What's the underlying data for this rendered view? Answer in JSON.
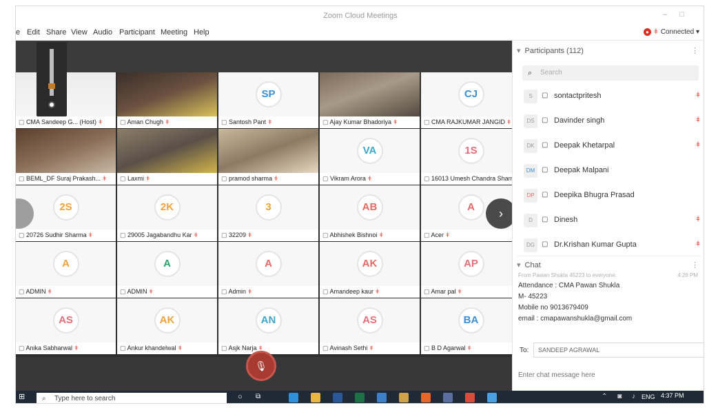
{
  "window": {
    "title": "Zoom Cloud Meetings"
  },
  "menu": {
    "items": [
      "e",
      "Edit",
      "Share",
      "View",
      "Audio",
      "Participant",
      "Meeting",
      "Help"
    ],
    "status": "Connected"
  },
  "tiles": [
    {
      "name": "CMA Sandeep G... (Host)",
      "kind": "video-dark",
      "initials": ""
    },
    {
      "name": "Aman Chugh",
      "kind": "video",
      "initials": ""
    },
    {
      "name": "Santosh Pant",
      "kind": "avatar",
      "initials": "SP",
      "color": "blue"
    },
    {
      "name": "Ajay Kumar Bhadoriya",
      "kind": "video",
      "initials": ""
    },
    {
      "name": "CMA RAJKUMAR JANGID",
      "kind": "avatar",
      "initials": "CJ",
      "color": "blue"
    },
    {
      "name": "BEML_DF Suraj Prakash...",
      "kind": "video",
      "initials": ""
    },
    {
      "name": "Laxmi",
      "kind": "video",
      "initials": ""
    },
    {
      "name": "pramod sharma",
      "kind": "video",
      "initials": ""
    },
    {
      "name": "Vikram Arora",
      "kind": "avatar",
      "initials": "VA",
      "color": "teal"
    },
    {
      "name": "16013 Umesh Chandra Sharma",
      "kind": "avatar",
      "initials": "1S",
      "color": "pink"
    },
    {
      "name": "20726 Sudhir Sharma",
      "kind": "avatar",
      "initials": "2S",
      "color": "orange"
    },
    {
      "name": "29005 Jagabandhu Kar",
      "kind": "avatar",
      "initials": "2K",
      "color": "orange"
    },
    {
      "name": "32209",
      "kind": "avatar",
      "initials": "3",
      "color": "orange"
    },
    {
      "name": "Abhishek Bishnoi",
      "kind": "avatar",
      "initials": "AB",
      "color": "red"
    },
    {
      "name": "Acer",
      "kind": "avatar",
      "initials": "A",
      "color": "red"
    },
    {
      "name": "ADMIN",
      "kind": "avatar",
      "initials": "A",
      "color": "orange"
    },
    {
      "name": "ADMIN",
      "kind": "avatar",
      "initials": "A",
      "color": "green"
    },
    {
      "name": "Admin",
      "kind": "avatar",
      "initials": "A",
      "color": "red"
    },
    {
      "name": "Amandeep kaur",
      "kind": "avatar",
      "initials": "AK",
      "color": "red"
    },
    {
      "name": "Amar pal",
      "kind": "avatar",
      "initials": "AP",
      "color": "pink"
    },
    {
      "name": "Anika Sabharwal",
      "kind": "avatar",
      "initials": "AS",
      "color": "pink"
    },
    {
      "name": "Ankur khandelwal",
      "kind": "avatar",
      "initials": "AK",
      "color": "orange"
    },
    {
      "name": "Asjk Narja",
      "kind": "avatar",
      "initials": "AN",
      "color": "teal"
    },
    {
      "name": "Avinash Sethi",
      "kind": "avatar",
      "initials": "AS",
      "color": "pink"
    },
    {
      "name": "B D Agarwal",
      "kind": "avatar",
      "initials": "BA",
      "color": "blue"
    }
  ],
  "participants": {
    "header": "Participants (112)",
    "search_placeholder": "Search",
    "list": [
      {
        "initials": "S",
        "name": "sontactpritesh"
      },
      {
        "initials": "DS",
        "name": "Davinder singh"
      },
      {
        "initials": "DK",
        "name": "Deepak Khetarpal"
      },
      {
        "initials": "DM",
        "name": "Deepak Malpani"
      },
      {
        "initials": "DP",
        "name": "Deepika Bhugra Prasad"
      },
      {
        "initials": "D",
        "name": "Dinesh"
      },
      {
        "initials": "DG",
        "name": "Dr.Krishan Kumar Gupta"
      }
    ]
  },
  "chat": {
    "header": "Chat",
    "from": "From Pawan Shukla 45223 to everyone:",
    "time": "4:26 PM",
    "lines": [
      "Attendance : CMA Pawan Shukla",
      "M- 45223",
      "Mobile no 9013679409",
      "email : cmapawanshukla@gmail.com"
    ],
    "to_label": "To:",
    "recipient": "SANDEEP AGRAWAL",
    "input_placeholder": "Enter chat message here"
  },
  "taskbar": {
    "search_placeholder": "Type here to search",
    "lang": "ENG",
    "time": "4:37 PM"
  },
  "colors": {
    "blue": "#3a8fd6",
    "orange": "#f0a23a",
    "green": "#2aa66a",
    "red": "#e46a64",
    "pink": "#e26f7a",
    "teal": "#3fa8c8",
    "mute_red": "#a83a32"
  }
}
